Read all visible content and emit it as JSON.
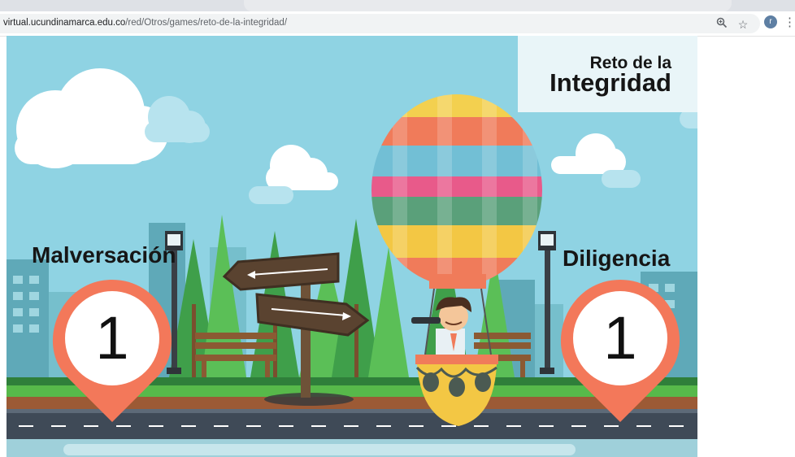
{
  "browser": {
    "url_domain": "virtual.ucundinamarca.edu.co",
    "url_path": "/red/Otros/games/reto-de-la-integridad/",
    "icons": [
      "zoom-icon",
      "star-icon"
    ],
    "profile_initial": "r",
    "menu_glyph": "⋮"
  },
  "game": {
    "title_line1": "Reto de la",
    "title_line2": "Integridad",
    "left": {
      "label": "Malversación",
      "count": "1"
    },
    "right": {
      "label": "Diligencia",
      "count": "1"
    },
    "colors": {
      "sky": "#8fd3e3",
      "pin": "#f3785a",
      "grass": "#57b94a",
      "road": "#3f4a57"
    }
  }
}
